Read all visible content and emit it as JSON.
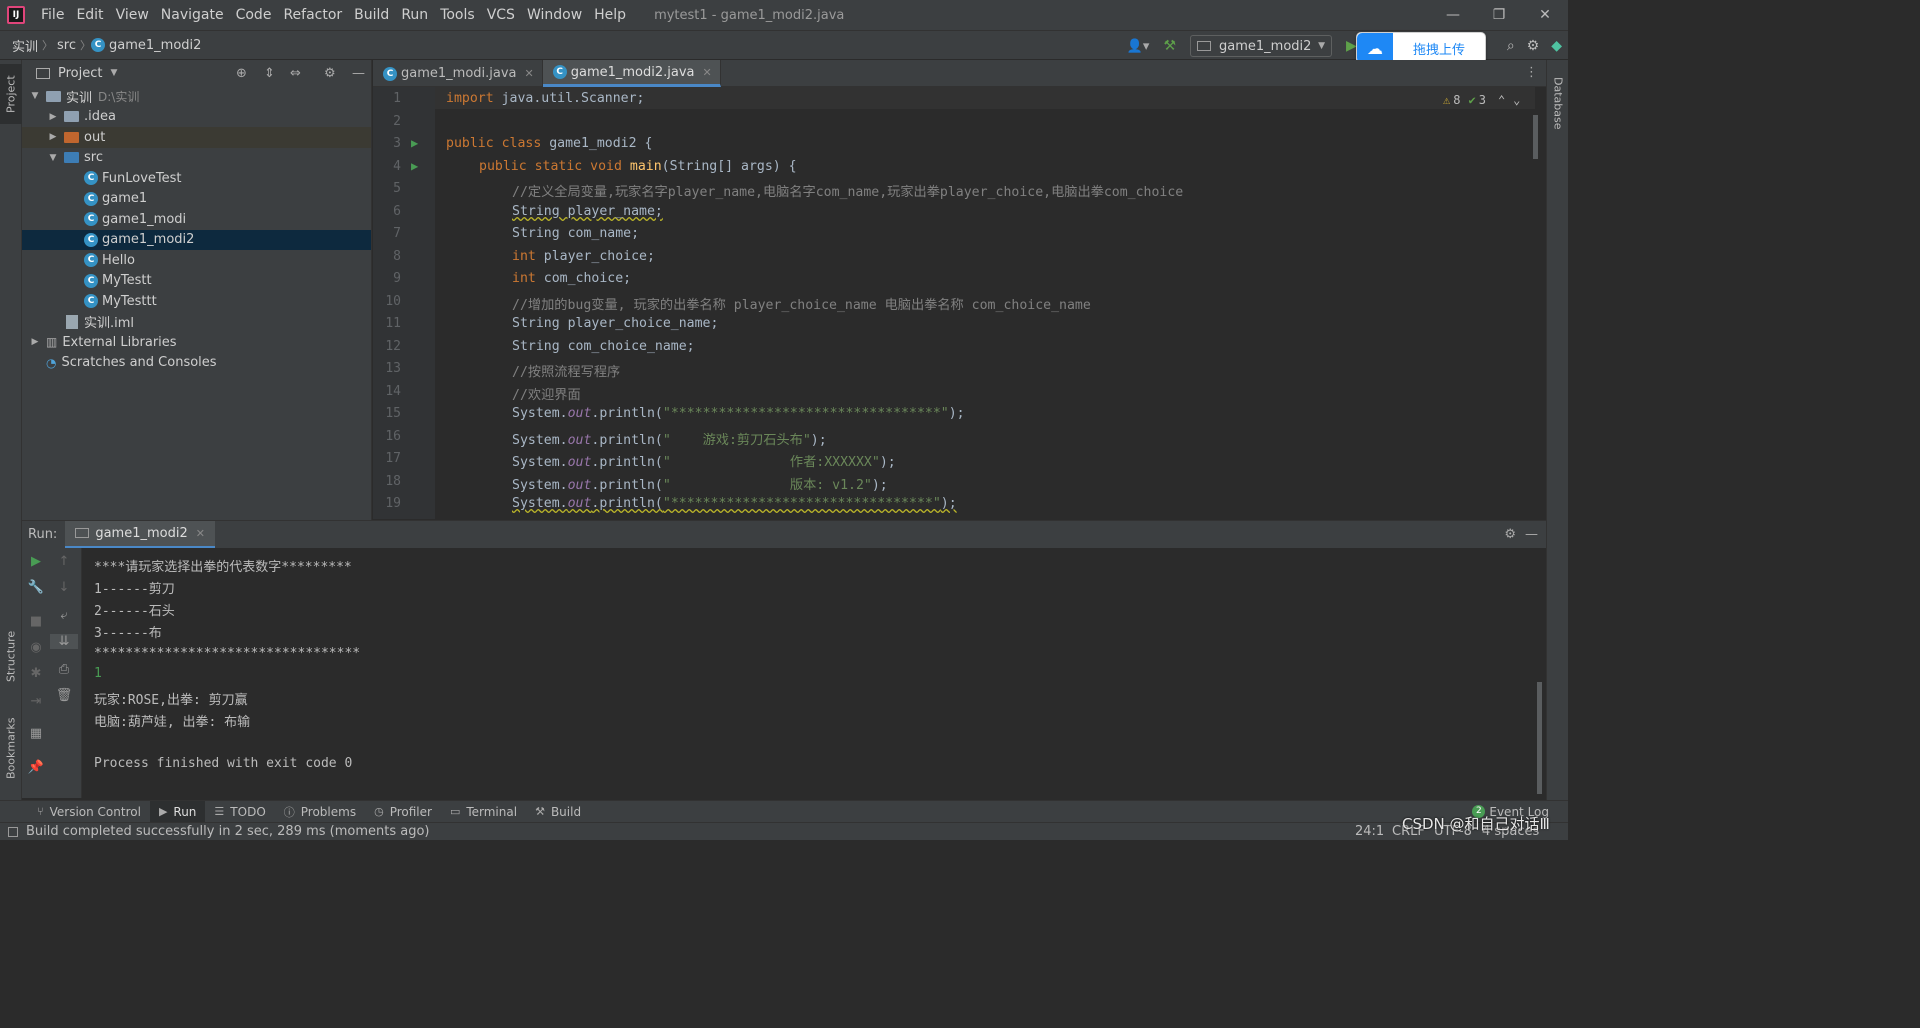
{
  "titlebar": {
    "menu": [
      "File",
      "Edit",
      "View",
      "Navigate",
      "Code",
      "Refactor",
      "Build",
      "Run",
      "Tools",
      "VCS",
      "Window",
      "Help"
    ],
    "window_title": "mytest1 - game1_modi2.java",
    "minimize": "—",
    "restore": "❐",
    "close": "✕"
  },
  "navbar": {
    "crumbs": [
      "实训",
      "src",
      "game1_modi2"
    ],
    "run_config": "game1_modi2",
    "upload_label": "拖拽上传"
  },
  "project": {
    "title": "Project",
    "root": {
      "name": "实训",
      "path": "D:\\实训"
    },
    "items": [
      {
        "label": ".idea"
      },
      {
        "label": "out"
      },
      {
        "label": "src"
      },
      {
        "label": "FunLoveTest"
      },
      {
        "label": "game1"
      },
      {
        "label": "game1_modi"
      },
      {
        "label": "game1_modi2"
      },
      {
        "label": "Hello"
      },
      {
        "label": "MyTestt"
      },
      {
        "label": "MyTesttt"
      },
      {
        "label": "实训.iml"
      },
      {
        "label": "External Libraries"
      },
      {
        "label": "Scratches and Consoles"
      }
    ]
  },
  "editor": {
    "tabs": [
      {
        "label": "game1_modi.java",
        "active": false
      },
      {
        "label": "game1_modi2.java",
        "active": true
      }
    ],
    "inspections": {
      "warnings": "8",
      "checks": "3"
    },
    "lines": [
      "1",
      "2",
      "3",
      "4",
      "5",
      "6",
      "7",
      "8",
      "9",
      "10",
      "11",
      "12",
      "13",
      "14",
      "15",
      "16",
      "17",
      "18",
      "19"
    ],
    "code": {
      "l1_kw": "import",
      "l1_rest": " java.util.Scanner;",
      "l3_kw": "public class",
      "l3_rest": " game1_modi2 {",
      "l4_kw": "public static void",
      "l4_fn": "main",
      "l4_rest": "(String[] args) {",
      "l5": "//定义全局变量,玩家名字player_name,电脑名字com_name,玩家出拳player_choice,电脑出拳com_choice",
      "l6": "String player_name;",
      "l7": "String com_name;",
      "l8_kw": "int",
      "l8_rest": " player_choice;",
      "l9_kw": "int",
      "l9_rest": " com_choice;",
      "l10": "//增加的bug变量, 玩家的出拳名称 player_choice_name 电脑出拳名称 com_choice_name",
      "l11": "String player_choice_name;",
      "l12": "String com_choice_name;",
      "l13": "//按照流程写程序",
      "l14": "//欢迎界面",
      "sys": "System.",
      "out": "out",
      "println": ".println(",
      "l15_str": "\"**********************************\"",
      "l16_str": "\"    游戏:剪刀石头布\"",
      "l17_str": "\"               作者:XXXXXX\"",
      "l18_str": "\"               版本: v1.2\"",
      "l19_str": "\"*********************************\"",
      "close": ");"
    }
  },
  "run": {
    "label": "Run:",
    "tab": "game1_modi2",
    "console": [
      "****请玩家选择出拳的代表数字*********",
      "1------剪刀",
      "2------石头",
      "3------布",
      "**********************************",
      "1",
      "玩家:ROSE,出拳: 剪刀赢",
      "电脑:葫芦娃, 出拳: 布输",
      "",
      "Process finished with exit code 0"
    ]
  },
  "side_tabs": {
    "project": "Project",
    "structure": "Structure",
    "bookmarks": "Bookmarks",
    "database": "Database"
  },
  "bottom_tools": [
    {
      "label": "Version Control",
      "icon": "branch-icon"
    },
    {
      "label": "Run",
      "icon": "run-icon"
    },
    {
      "label": "TODO",
      "icon": "list-icon"
    },
    {
      "label": "Problems",
      "icon": "info-icon"
    },
    {
      "label": "Profiler",
      "icon": "gauge-icon"
    },
    {
      "label": "Terminal",
      "icon": "terminal-icon"
    },
    {
      "label": "Build",
      "icon": "hammer-icon"
    }
  ],
  "event_log": {
    "label": "Event Log",
    "count": "2"
  },
  "status": {
    "message": "Build completed successfully in 2 sec, 289 ms (moments ago)",
    "position": "24:1",
    "line_sep": "CRLF",
    "encoding": "UTF-8",
    "indent": "4 spaces",
    "watermark": "CSDN @和自己对话Ⅲ"
  },
  "colors": {
    "accent": "#4a88c7",
    "keyword": "#cc7832",
    "string": "#6a8759",
    "comment": "#808080"
  }
}
